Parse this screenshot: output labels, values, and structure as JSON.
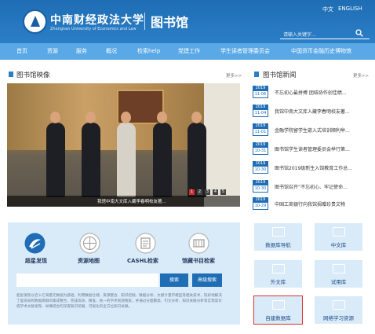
{
  "header": {
    "brand_cn": "中南财经政法大学",
    "brand_en": "Zhongnan University of Economics and Law",
    "library_title": "图书馆",
    "lang_cn": "中文",
    "lang_en": "ENGLISH",
    "search_placeholder": "请输入关键字..."
  },
  "nav": [
    "首页",
    "资源",
    "服务",
    "概况",
    "检索help",
    "党建工作",
    "学生读者管理委员会",
    "中国货币金融历史博物馆"
  ],
  "photo_section": {
    "title": "图书馆映像",
    "more": "更多>>",
    "caption": "我馆中南大文库入藏李春明校友著...",
    "pager": [
      "1",
      "2",
      "3",
      "4",
      "5"
    ]
  },
  "news": {
    "title": "图书馆新闻",
    "more": "更多>>",
    "items": [
      {
        "year": "2019",
        "date": "11-06",
        "title": "不忘初心最拼搏 团结协作创佳绩..."
      },
      {
        "year": "2019",
        "date": "11-04",
        "title": "我馆中南大文库入藏李春明校友著..."
      },
      {
        "year": "2019",
        "date": "11-01",
        "title": "金融学院留学生嵌入式培训顺利举..."
      },
      {
        "year": "2019",
        "date": "10-31",
        "title": "图书馆学生读者管理委员会举行第..."
      },
      {
        "year": "2019",
        "date": "10-30",
        "title": "图书馆2019级新生入馆教育工作总..."
      },
      {
        "year": "2019",
        "date": "10-30",
        "title": "图书馆召开“不忘初心、牢记使命..."
      },
      {
        "year": "2019",
        "date": "10-29",
        "title": "中国工商银行向我馆捐赠珍贵文物"
      }
    ]
  },
  "quick_search": {
    "links": [
      "超星发现",
      "资源地图",
      "CASHL检索",
      "馆藏书目检索"
    ],
    "search_button": "搜索",
    "advanced_button": "高级搜索",
    "description": "超星发现以近十亿海量元数据为基础，利用数据仓储、资源整合、知识挖掘、数据分析、文献计量学模型等相关技术，较好地解决了复杂异构数据库群的集成整合，完成高效、精准、统一的学术资源搜索，并通过分面聚类、引文分析、知识关联分析等实现高价值学术文献发现、纵横结合的深度知识挖掘、可视化的全方位知识关联。"
  },
  "tiles": [
    "数据库导航",
    "中文库",
    "外文库",
    "试用库",
    "自建数据库",
    "网络学习资源"
  ],
  "colors": {
    "header": "#1f6db5",
    "nav": "#5aa9e6",
    "highlight_border": "#e0302a",
    "panel": "#d9ebf8"
  }
}
